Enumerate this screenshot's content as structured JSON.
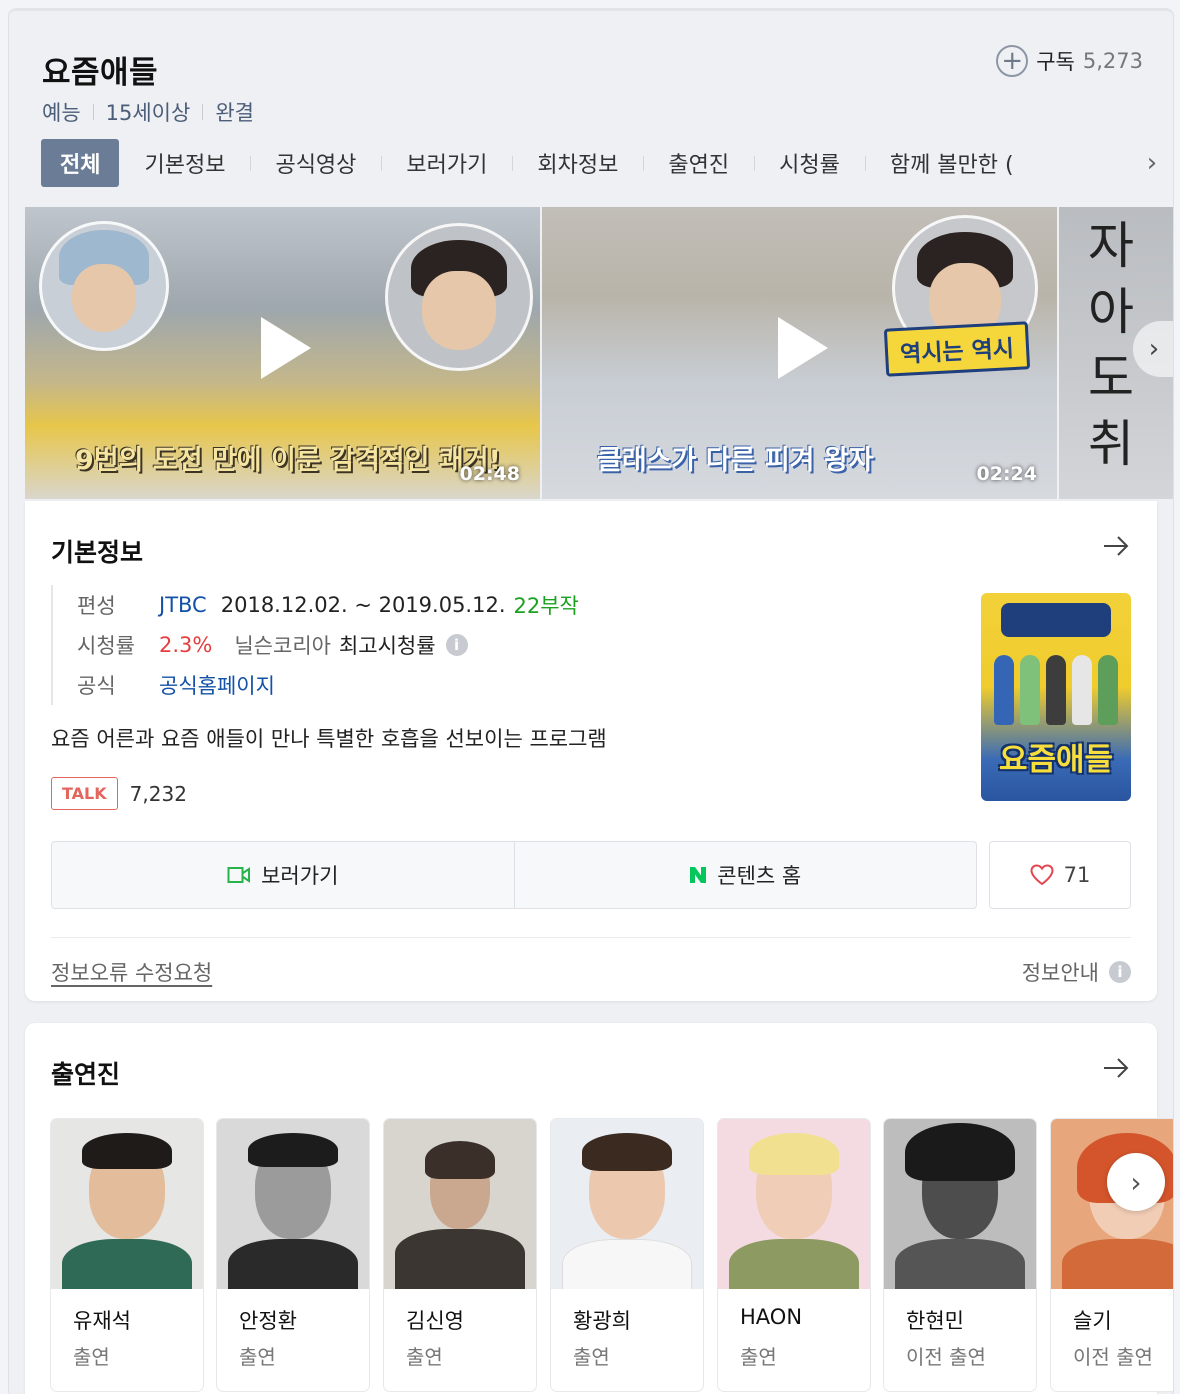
{
  "program": {
    "title": "요즘애들",
    "genre": "예능",
    "rating": "15세이상",
    "status": "완결",
    "subscribe_label": "구독",
    "subscribe_count": "5,273"
  },
  "tabs": [
    "전체",
    "기본정보",
    "공식영상",
    "보러가기",
    "회차정보",
    "출연진",
    "시청률",
    "함께 볼만한 ("
  ],
  "videos": [
    {
      "caption": "9번의 도전 만에 이룬 감격적인 쾌거!",
      "duration": "02:48"
    },
    {
      "caption": "클래스가 다른 피겨 왕자",
      "banner": "역시는 역시",
      "duration": "02:24"
    },
    {
      "calligraphy": "자아도취"
    }
  ],
  "basic_info": {
    "title": "기본정보",
    "broadcast_label": "편성",
    "channel": "JTBC",
    "period": "2018.12.02. ~ 2019.05.12.",
    "episodes": "22부작",
    "ratings_label": "시청률",
    "ratings_value": "2.3%",
    "ratings_source": "닐슨코리아",
    "ratings_note": "최고시청률",
    "official_label": "공식",
    "official_link": "공식홈페이지",
    "description": "요즘 어른과 요즘 애들이 만나 특별한 호흡을 선보이는 프로그램",
    "talk_badge": "TALK",
    "talk_count": "7,232",
    "poster_title": "요즘애들",
    "watch_button": "보러가기",
    "content_home_button": "콘텐츠 홈",
    "like_count": "71",
    "report_link": "정보오류 수정요청",
    "info_guide": "정보안내"
  },
  "cast": {
    "title": "출연진",
    "members": [
      {
        "name": "유재석",
        "role": "출연"
      },
      {
        "name": "안정환",
        "role": "출연"
      },
      {
        "name": "김신영",
        "role": "출연"
      },
      {
        "name": "황광희",
        "role": "출연"
      },
      {
        "name": "HAON",
        "role": "출연"
      },
      {
        "name": "한현민",
        "role": "이전 출연"
      },
      {
        "name": "슬기",
        "role": "이전 출연"
      }
    ]
  },
  "colors": {
    "active_tab": "#6b7d96",
    "link_blue": "#1352a6",
    "episodes_green": "#1ba120",
    "rating_red": "#e63e3e",
    "talk_red": "#e4655d",
    "naver_green": "#03c75a"
  },
  "icons": {
    "subscribe": "plus-circle-icon",
    "tabs_next": "chevron-right-icon",
    "play": "play-icon",
    "more": "arrow-right-icon",
    "info": "info-icon",
    "watch": "video-camera-icon",
    "content_home": "naver-n-icon",
    "like": "heart-icon"
  }
}
